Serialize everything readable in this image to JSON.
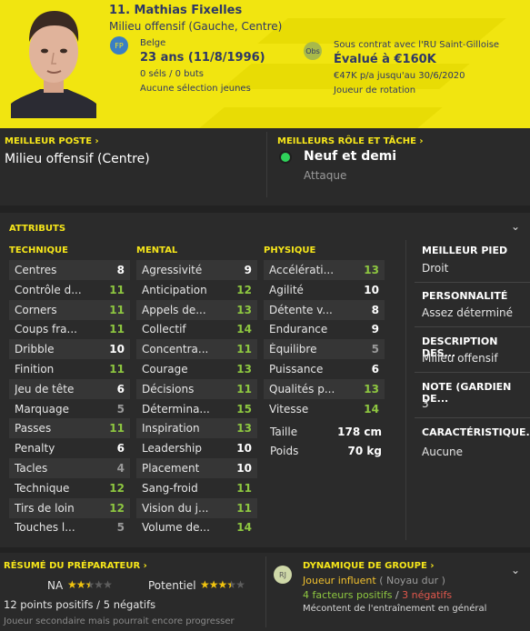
{
  "header": {
    "name": "11. Mathias Fixelles",
    "position": "Milieu offensif (Gauche, Centre)",
    "nation_badge": "FP",
    "nationality": "Belge",
    "age": "23 ans (11/8/1996)",
    "caps": "0 séls / 0 buts",
    "youth": "Aucune sélection jeunes",
    "obs_badge": "Obs",
    "contract": "Sous contrat avec l'RU Saint-Gilloise",
    "value": "Évalué à €160K",
    "wage": "€47K p/a jusqu'au 30/6/2020",
    "role_status": "Joueur de rotation"
  },
  "best_position": {
    "label": "MEILLEUR POSTE",
    "value": "Milieu offensif (Centre)"
  },
  "best_role": {
    "label": "MEILLEURS RÔLE ET TÂCHE",
    "role": "Neuf et demi",
    "duty": "Attaque"
  },
  "attributes": {
    "title": "ATTRIBUTS",
    "technique_title": "TECHNIQUE",
    "mental_title": "MENTAL",
    "physique_title": "PHYSIQUE",
    "technique": [
      {
        "name": "Centres",
        "value": "8"
      },
      {
        "name": "Contrôle d...",
        "value": "11"
      },
      {
        "name": "Corners",
        "value": "11"
      },
      {
        "name": "Coups fra...",
        "value": "11"
      },
      {
        "name": "Dribble",
        "value": "10"
      },
      {
        "name": "Finition",
        "value": "11"
      },
      {
        "name": "Jeu de tête",
        "value": "6"
      },
      {
        "name": "Marquage",
        "value": "5"
      },
      {
        "name": "Passes",
        "value": "11"
      },
      {
        "name": "Penalty",
        "value": "6"
      },
      {
        "name": "Tacles",
        "value": "4"
      },
      {
        "name": "Technique",
        "value": "12"
      },
      {
        "name": "Tirs de loin",
        "value": "12"
      },
      {
        "name": "Touches l...",
        "value": "5"
      }
    ],
    "mental": [
      {
        "name": "Agressivité",
        "value": "9"
      },
      {
        "name": "Anticipation",
        "value": "12"
      },
      {
        "name": "Appels de...",
        "value": "13"
      },
      {
        "name": "Collectif",
        "value": "14"
      },
      {
        "name": "Concentra...",
        "value": "11"
      },
      {
        "name": "Courage",
        "value": "13"
      },
      {
        "name": "Décisions",
        "value": "11"
      },
      {
        "name": "Détermina...",
        "value": "15"
      },
      {
        "name": "Inspiration",
        "value": "13"
      },
      {
        "name": "Leadership",
        "value": "10"
      },
      {
        "name": "Placement",
        "value": "10"
      },
      {
        "name": "Sang-froid",
        "value": "11"
      },
      {
        "name": "Vision du j...",
        "value": "11"
      },
      {
        "name": "Volume de...",
        "value": "14"
      }
    ],
    "physique": [
      {
        "name": "Accélérati...",
        "value": "13"
      },
      {
        "name": "Agilité",
        "value": "10"
      },
      {
        "name": "Détente v...",
        "value": "8"
      },
      {
        "name": "Endurance",
        "value": "9"
      },
      {
        "name": "Équilibre",
        "value": "5"
      },
      {
        "name": "Puissance",
        "value": "6"
      },
      {
        "name": "Qualités p...",
        "value": "13"
      },
      {
        "name": "Vitesse",
        "value": "14"
      }
    ],
    "height_label": "Taille",
    "height": "178 cm",
    "weight_label": "Poids",
    "weight": "70 kg"
  },
  "side": {
    "foot_label": "MEILLEUR PIED",
    "foot": "Droit",
    "personality_label": "PERSONNALITÉ",
    "personality": "Assez déterminé",
    "description_label": "DESCRIPTION DES...",
    "description": "Milieu offensif",
    "gk_label": "NOTE (GARDIEN DE...",
    "gk": "3",
    "traits_label": "CARACTÉRISTIQUE...",
    "traits": "Aucune"
  },
  "coach": {
    "title": "RÉSUMÉ DU PRÉPARATEUR",
    "current_label": "NA",
    "current_stars": 2.5,
    "potential_label": "Potentiel",
    "potential_stars": 3.5,
    "summary": "12 points positifs / 5 négatifs",
    "note": "Joueur secondaire mais pourrait encore progresser"
  },
  "dynamics": {
    "title": "DYNAMIQUE DE GROUPE",
    "badge": "RJ",
    "status": "Joueur influent",
    "group": "( Noyau dur )",
    "positives": "4 facteurs positifs",
    "separator": "/",
    "negatives": "3 négatifs",
    "note": "Mécontent de l'entraînement en général"
  },
  "colors": {
    "header_yellow": "#f1e510",
    "accent_yellow": "#f6e61a",
    "good_green": "#8ec740",
    "negative_red": "#e2574c",
    "navy": "#2d3766"
  }
}
